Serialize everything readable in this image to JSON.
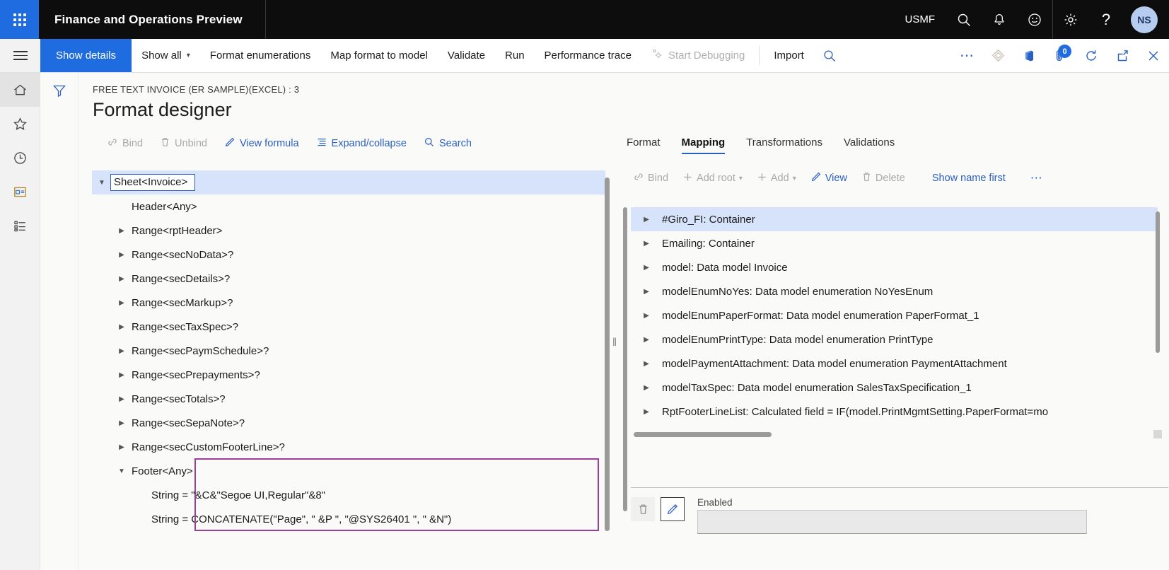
{
  "topbar": {
    "app_title": "Finance and Operations Preview",
    "company": "USMF",
    "icons": [
      "search-icon",
      "bell-icon",
      "smiley-icon",
      "gear-icon",
      "help-icon"
    ],
    "avatar_initials": "NS"
  },
  "commandbar": {
    "primary": "Show details",
    "items": [
      {
        "label": "Show all",
        "caret": true,
        "disabled": false
      },
      {
        "label": "Format enumerations",
        "caret": false,
        "disabled": false
      },
      {
        "label": "Map format to model",
        "caret": false,
        "disabled": false
      },
      {
        "label": "Validate",
        "caret": false,
        "disabled": false
      },
      {
        "label": "Run",
        "caret": false,
        "disabled": false
      },
      {
        "label": "Performance trace",
        "caret": false,
        "disabled": false
      },
      {
        "label": "Start Debugging",
        "caret": false,
        "disabled": true
      },
      {
        "label": "Import",
        "caret": false,
        "disabled": false
      }
    ],
    "attachment_badge": "0"
  },
  "rail": {
    "items": [
      {
        "name": "home-icon",
        "active": true
      },
      {
        "name": "star-icon",
        "active": false
      },
      {
        "name": "clock-icon",
        "active": false
      },
      {
        "name": "workspace-icon",
        "active": false
      },
      {
        "name": "list-icon",
        "active": false
      }
    ]
  },
  "page": {
    "breadcrumb": "FREE TEXT INVOICE (ER SAMPLE)(EXCEL) : 3",
    "title": "Format designer"
  },
  "left_toolbar": [
    {
      "label": "Bind",
      "icon": "bind-icon",
      "disabled": true
    },
    {
      "label": "Unbind",
      "icon": "trash-icon",
      "disabled": true
    },
    {
      "label": "View formula",
      "icon": "pencil-icon",
      "disabled": false
    },
    {
      "label": "Expand/collapse",
      "icon": "list-lines-icon",
      "disabled": false
    },
    {
      "label": "Search",
      "icon": "search-icon",
      "disabled": false
    }
  ],
  "format_tree": [
    {
      "label": "Sheet<Invoice>",
      "twist": "expanded",
      "indent": 0,
      "selected": true
    },
    {
      "label": "Header<Any>",
      "twist": "none",
      "indent": 1,
      "selected": false
    },
    {
      "label": "Range<rptHeader>",
      "twist": "collapsed",
      "indent": 1,
      "selected": false
    },
    {
      "label": "Range<secNoData>?",
      "twist": "collapsed",
      "indent": 1,
      "selected": false
    },
    {
      "label": "Range<secDetails>?",
      "twist": "collapsed",
      "indent": 1,
      "selected": false
    },
    {
      "label": "Range<secMarkup>?",
      "twist": "collapsed",
      "indent": 1,
      "selected": false
    },
    {
      "label": "Range<secTaxSpec>?",
      "twist": "collapsed",
      "indent": 1,
      "selected": false
    },
    {
      "label": "Range<secPaymSchedule>?",
      "twist": "collapsed",
      "indent": 1,
      "selected": false
    },
    {
      "label": "Range<secPrepayments>?",
      "twist": "collapsed",
      "indent": 1,
      "selected": false
    },
    {
      "label": "Range<secTotals>?",
      "twist": "collapsed",
      "indent": 1,
      "selected": false
    },
    {
      "label": "Range<secSepaNote>?",
      "twist": "collapsed",
      "indent": 1,
      "selected": false
    },
    {
      "label": "Range<secCustomFooterLine>?",
      "twist": "collapsed",
      "indent": 1,
      "selected": false
    },
    {
      "label": "Footer<Any>",
      "twist": "expanded",
      "indent": 1,
      "selected": false
    },
    {
      "label": "String = \"&C&\"Segoe UI,Regular\"&8\"",
      "twist": "none",
      "indent": 2,
      "selected": false
    },
    {
      "label": "String = CONCATENATE(\"Page\", \" &P \", \"@SYS26401 \", \" &N\")",
      "twist": "none",
      "indent": 2,
      "selected": false
    }
  ],
  "right_tabs": [
    {
      "label": "Format",
      "active": false
    },
    {
      "label": "Mapping",
      "active": true
    },
    {
      "label": "Transformations",
      "active": false
    },
    {
      "label": "Validations",
      "active": false
    }
  ],
  "right_toolbar": [
    {
      "label": "Bind",
      "icon": "bind-icon",
      "disabled": true,
      "caret": false
    },
    {
      "label": "Add root",
      "icon": "plus-icon",
      "disabled": true,
      "caret": true
    },
    {
      "label": "Add",
      "icon": "plus-icon",
      "disabled": true,
      "caret": true
    },
    {
      "label": "View",
      "icon": "pencil-icon",
      "disabled": false,
      "caret": false
    },
    {
      "label": "Delete",
      "icon": "trash-icon",
      "disabled": true,
      "caret": false
    },
    {
      "label": "Show name first",
      "icon": "",
      "disabled": false,
      "caret": false
    }
  ],
  "right_toolbar_overflow": "⋯",
  "mapping_tree": [
    {
      "label": "#Giro_FI: Container",
      "selected": true
    },
    {
      "label": "Emailing: Container",
      "selected": false
    },
    {
      "label": "model: Data model Invoice",
      "selected": false
    },
    {
      "label": "modelEnumNoYes: Data model enumeration NoYesEnum",
      "selected": false
    },
    {
      "label": "modelEnumPaperFormat: Data model enumeration PaperFormat_1",
      "selected": false
    },
    {
      "label": "modelEnumPrintType: Data model enumeration PrintType",
      "selected": false
    },
    {
      "label": "modelPaymentAttachment: Data model enumeration PaymentAttachment",
      "selected": false
    },
    {
      "label": "modelTaxSpec: Data model enumeration SalesTaxSpecification_1",
      "selected": false
    },
    {
      "label": "RptFooterLineList: Calculated field = IF(model.PrintMgmtSetting.PaperFormat=mo",
      "selected": false
    }
  ],
  "detail": {
    "delete_icon": "trash-icon",
    "edit_icon": "pencil-icon",
    "field_label": "Enabled",
    "field_value": ""
  },
  "colors": {
    "accent": "#1f6ce0",
    "link": "#2b5fc0",
    "selection": "#d6e3fa",
    "highlight_border": "#9b3f9b",
    "topbar_bg": "#0d0d0d",
    "canvas": "#fafaf9"
  }
}
